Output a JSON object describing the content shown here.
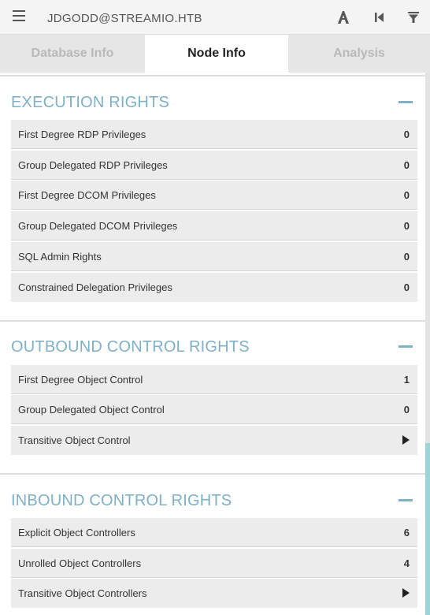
{
  "header": {
    "node_name": "JDGODD@STREAMIO.HTB",
    "icons": [
      "menu-icon",
      "pathfinding-icon",
      "back-icon",
      "filter-icon"
    ]
  },
  "tabs": [
    {
      "label": "Database Info",
      "active": false
    },
    {
      "label": "Node Info",
      "active": true
    },
    {
      "label": "Analysis",
      "active": false
    }
  ],
  "sections": {
    "execution": {
      "title": "EXECUTION RIGHTS",
      "rows": [
        {
          "label": "First Degree RDP Privileges",
          "value": "0"
        },
        {
          "label": "Group Delegated RDP Privileges",
          "value": "0"
        },
        {
          "label": "First Degree DCOM Privileges",
          "value": "0"
        },
        {
          "label": "Group Delegated DCOM Privileges",
          "value": "0"
        },
        {
          "label": "SQL Admin Rights",
          "value": "0"
        },
        {
          "label": "Constrained Delegation Privileges",
          "value": "0"
        }
      ]
    },
    "outbound": {
      "title": "OUTBOUND CONTROL RIGHTS",
      "rows": [
        {
          "label": "First Degree Object Control",
          "value": "1"
        },
        {
          "label": "Group Delegated Object Control",
          "value": "0"
        },
        {
          "label": "Transitive Object Control",
          "value": null
        }
      ]
    },
    "inbound": {
      "title": "INBOUND CONTROL RIGHTS",
      "rows": [
        {
          "label": "Explicit Object Controllers",
          "value": "6"
        },
        {
          "label": "Unrolled Object Controllers",
          "value": "4"
        },
        {
          "label": "Transitive Object Controllers",
          "value": null
        }
      ]
    }
  },
  "colors": {
    "accent": "#7fb0c6",
    "row_bg": "#ececec",
    "scroll_thumb": "#9fd4d7"
  }
}
